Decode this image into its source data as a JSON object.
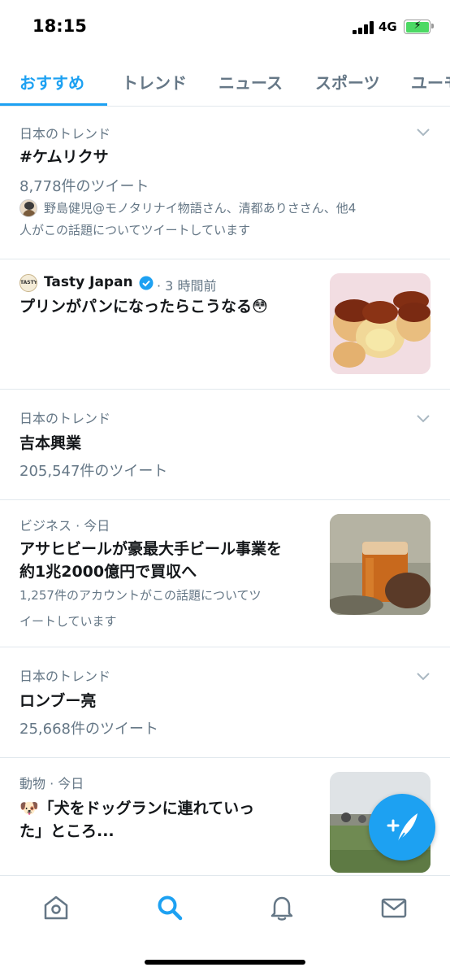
{
  "status_bar": {
    "time": "18:15",
    "network": "4G"
  },
  "tabs": [
    {
      "label": "おすすめ"
    },
    {
      "label": "トレンド"
    },
    {
      "label": "ニュース"
    },
    {
      "label": "スポーツ"
    },
    {
      "label": "ユーモ"
    }
  ],
  "feed": {
    "trend1": {
      "meta": "日本のトレンド",
      "title": "#ケムリクサ",
      "count": "8,778件のツイート",
      "desc_line1": "野島健児@モノタリナイ物語さん、清都ありささん、他4",
      "desc_line2": "人がこの話題についてツイートしています"
    },
    "tasty": {
      "author": "Tasty Japan",
      "time": "· 3 時間前",
      "title": "プリンがパンになったらこうなる😳",
      "avatar_text": "TASTY"
    },
    "trend2": {
      "meta": "日本のトレンド",
      "title": "吉本興業",
      "count": "205,547件のツイート"
    },
    "business": {
      "meta": "ビジネス · 今日",
      "title_line1": "アサヒビールが豪最大手ビール事業を",
      "title_line2": "約1兆2000億円で買収へ",
      "desc_line1": "1,257件のアカウントがこの話題についてツ",
      "desc_line2": "イートしています"
    },
    "trend3": {
      "meta": "日本のトレンド",
      "title": "ロンブー亮",
      "count": "25,668件のツイート"
    },
    "animal": {
      "meta": "動物 · 今日",
      "title_line1": "🐶「犬をドッグランに連れていっ",
      "title_line2": "た」ところ..."
    }
  },
  "colors": {
    "accent": "#1da1f2",
    "secondary_text": "#657786",
    "divider": "#e1e8ed"
  }
}
